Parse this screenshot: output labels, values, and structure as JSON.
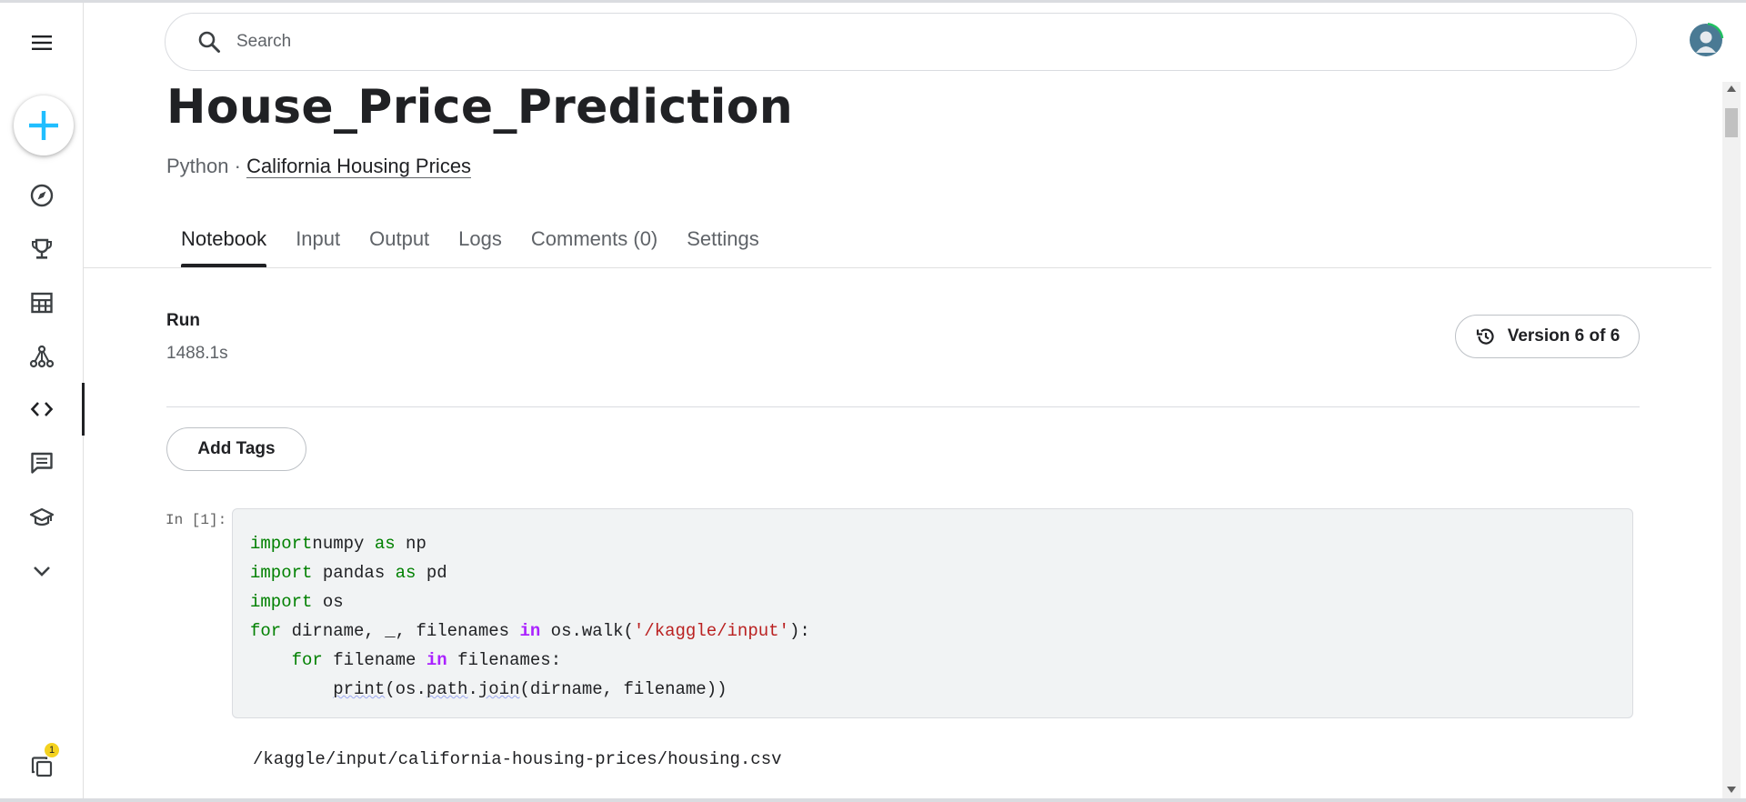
{
  "search": {
    "placeholder": "Search"
  },
  "sidebar": {
    "items": [
      {
        "name": "menu",
        "icon": "hamburger-menu-icon"
      },
      {
        "name": "create",
        "icon": "plus-icon",
        "accent": "#20beff"
      },
      {
        "name": "home",
        "icon": "compass-icon"
      },
      {
        "name": "competitions",
        "icon": "trophy-icon"
      },
      {
        "name": "datasets",
        "icon": "table-icon"
      },
      {
        "name": "models",
        "icon": "models-icon"
      },
      {
        "name": "code",
        "icon": "code-icon",
        "active": true
      },
      {
        "name": "discussions",
        "icon": "comments-icon"
      },
      {
        "name": "learn",
        "icon": "graduation-cap-icon"
      },
      {
        "name": "more",
        "icon": "chevron-down-icon"
      },
      {
        "name": "notebooks-viewed",
        "icon": "layers-icon",
        "badge": "1"
      }
    ]
  },
  "notebook": {
    "title": "House_Price_Prediction",
    "language": "Python",
    "separator": " · ",
    "dataset_link": "California Housing Prices"
  },
  "tabs": [
    {
      "label": "Notebook",
      "active": true
    },
    {
      "label": "Input"
    },
    {
      "label": "Output"
    },
    {
      "label": "Logs"
    },
    {
      "label": "Comments (0)"
    },
    {
      "label": "Settings"
    }
  ],
  "run": {
    "label": "Run",
    "value": "1488.1s"
  },
  "version_button": {
    "label": "Version 6 of 6"
  },
  "add_tags_button": {
    "label": "Add Tags"
  },
  "cell": {
    "prompt": "In [1]:",
    "lines": [
      [
        [
          "kw",
          "import"
        ],
        [
          "",
          "numpy "
        ],
        [
          "kw",
          "as"
        ],
        [
          "",
          " np"
        ]
      ],
      [
        [
          "kw",
          "import"
        ],
        [
          "",
          " pandas "
        ],
        [
          "kw",
          "as"
        ],
        [
          "",
          " pd"
        ]
      ],
      [
        [
          "kw",
          "import"
        ],
        [
          "",
          " os"
        ]
      ],
      [
        [
          "kw",
          "for"
        ],
        [
          "",
          " dirname, _, filenames "
        ],
        [
          "op",
          "in"
        ],
        [
          "",
          " os.walk("
        ],
        [
          "str",
          "'/kaggle/input'"
        ],
        [
          "",
          "):"
        ]
      ],
      [
        [
          "",
          "    "
        ],
        [
          "kw",
          "for"
        ],
        [
          "",
          " filename "
        ],
        [
          "op",
          "in"
        ],
        [
          "",
          " filenames:"
        ]
      ],
      [
        [
          "",
          "        "
        ],
        [
          "fn",
          "print"
        ],
        [
          "",
          "(os."
        ],
        [
          "fn",
          "path"
        ],
        [
          "",
          "."
        ],
        [
          "fn",
          "join"
        ],
        [
          "",
          "(dirname, filename))"
        ]
      ]
    ],
    "output": "/kaggle/input/california-housing-prices/housing.csv"
  },
  "colors": {
    "accent": "#20beff",
    "keyword": "#008000",
    "operator": "#aa22ff",
    "string": "#ba2121",
    "badge": "#f4d21f"
  }
}
